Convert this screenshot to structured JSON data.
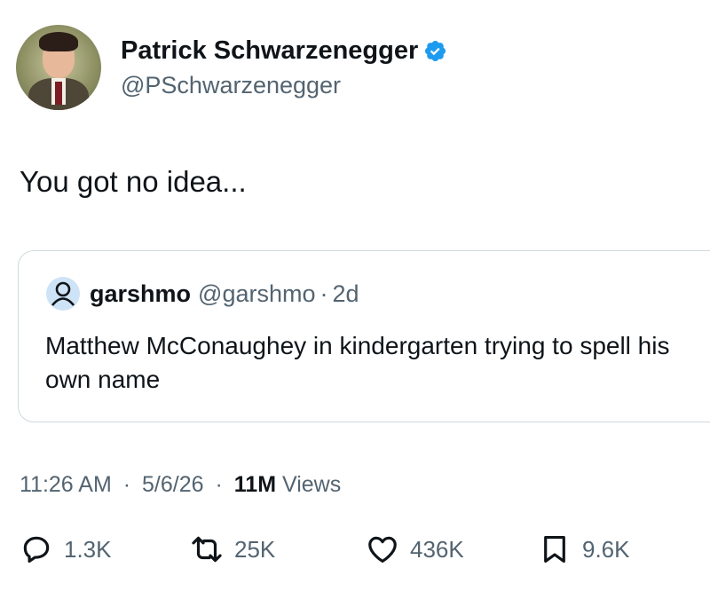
{
  "author": {
    "display_name": "Patrick Schwarzenegger",
    "handle": "@PSchwarzenegger",
    "verified_icon": "verified-badge-icon"
  },
  "tweet": {
    "text": "You got no idea..."
  },
  "quote": {
    "name": "garshmo",
    "handle": "@garshmo",
    "dot": "·",
    "time": "2d",
    "text": "Matthew McConaughey in kindergarten trying to spell his own name",
    "avatar_icon": "default-user-icon"
  },
  "meta": {
    "time": "11:26 AM",
    "date": "5/6/26",
    "separator": "·",
    "views_count": "11M",
    "views_label": "Views"
  },
  "actions": {
    "replies": "1.3K",
    "reposts": "25K",
    "likes": "436K",
    "bookmarks": "9.6K"
  },
  "colors": {
    "accent": "#1d9bf0",
    "text": "#0f1419",
    "secondary": "#536471",
    "border": "#cfd9de"
  }
}
